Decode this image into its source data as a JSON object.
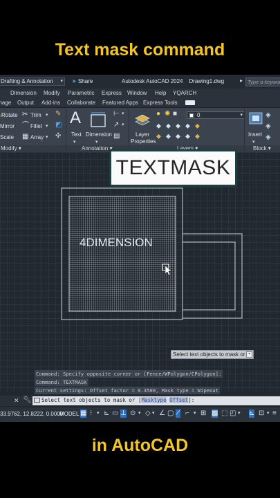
{
  "headline_top": "Text mask command",
  "headline_bottom": "in AutoCAD",
  "titlebar": {
    "workspace": "Drafting & Annotation",
    "share": "Share",
    "app_title": "Autodesk AutoCAD 2024",
    "document": "Drawing1.dwg",
    "search_placeholder": "Type a keyword"
  },
  "menu": [
    "Dimension",
    "Modify",
    "Parametric",
    "Express",
    "Window",
    "Help",
    "YQARCH"
  ],
  "ribbon_tabs": [
    "Image",
    "Output",
    "Add-ins",
    "Collaborate",
    "Featured Apps",
    "Express Tools"
  ],
  "ribbon": {
    "rotate": "Rotate",
    "trim": "Trim",
    "mirror": "Mirror",
    "fillet": "Fillet",
    "scale": "Scale",
    "array": "Array",
    "text": "Text",
    "dimension": "Dimension",
    "layer_properties_1": "Layer",
    "layer_properties_2": "Properties",
    "layer_value": "0",
    "insert": "Insert",
    "panels": {
      "modify": "Modify",
      "annotation": "Annotation",
      "layers": "Layers",
      "block": "Block"
    }
  },
  "overlay_label": "TEXTMASK",
  "drawing_text": "4DIMENSION",
  "tooltip": "Select text objects to mask or",
  "command_history": [
    "Command: Specify opposite corner or [Fence/WPolygon/CPolygon]:",
    "Command: TEXTMASK",
    "Current settings: Offset factor = 0.3500, Mask type = Wipeout"
  ],
  "command_prompt": {
    "prefix": "Select text objects to mask or [",
    "option1": "Masktype",
    "option2": "Offset",
    "suffix": "]:"
  },
  "status": {
    "coords": "33.9762, 12.8222, 0.0000",
    "model": "MODEL"
  },
  "colors": {
    "headline": "#f3c622",
    "canvas": "#212830",
    "accent": "#2f6fb6"
  }
}
